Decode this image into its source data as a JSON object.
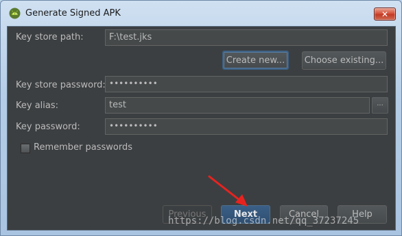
{
  "window": {
    "title": "Generate Signed APK",
    "close_label": "✕",
    "app_icon": "android-icon"
  },
  "form": {
    "key_store_path": {
      "label": "Key store path:",
      "value": "F:\\test.jks"
    },
    "create_new_label": "Create new...",
    "choose_existing_label": "Choose existing...",
    "key_store_password": {
      "label": "Key store password:",
      "value": "••••••••••"
    },
    "key_alias": {
      "label": "Key alias:",
      "value": "test",
      "browse_label": "..."
    },
    "key_password": {
      "label": "Key password:",
      "value": "••••••••••"
    },
    "remember_passwords": {
      "label": "Remember passwords",
      "checked": false
    }
  },
  "footer": {
    "previous_label": "Previous",
    "next_label": "Next",
    "cancel_label": "Cancel",
    "help_label": "Help"
  },
  "watermark": "https://blog.csdn.net/qq_37237245",
  "colors": {
    "dialog_bg": "#3c3f41",
    "field_bg": "#45494a",
    "default_button": "#365880",
    "annotation_arrow": "#e8231f",
    "title_bar": "#b9d1ea"
  }
}
